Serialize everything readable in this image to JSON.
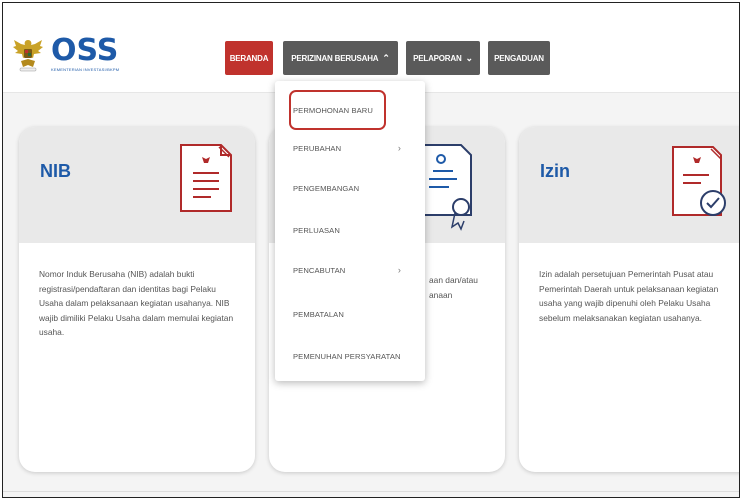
{
  "brand": {
    "logo_text": "OSS",
    "logo_subtext": "KEMENTERIAN INVESTASI/BKPM"
  },
  "nav": {
    "beranda": "BERANDA",
    "perizinan": "PERIZINAN BERUSAHA",
    "pelaporan": "PELAPORAN",
    "pengaduan": "PENGADUAN"
  },
  "dropdown": {
    "items": [
      {
        "label": "PERMOHONAN BARU",
        "has_submenu": false
      },
      {
        "label": "PERUBAHAN",
        "has_submenu": true
      },
      {
        "label": "PENGEMBANGAN",
        "has_submenu": false
      },
      {
        "label": "PERLUASAN",
        "has_submenu": false
      },
      {
        "label": "PENCABUTAN",
        "has_submenu": true
      },
      {
        "label": "PEMBATALAN",
        "has_submenu": false
      },
      {
        "label": "PEMENUHAN PERSYARATAN",
        "has_submenu": false
      }
    ]
  },
  "cards": {
    "nib": {
      "title": "NIB",
      "description": "Nomor Induk Berusaha (NIB) adalah bukti registrasi/pendaftaran dan identitas bagi Pelaku Usaha dalam pelaksanaan kegiatan usahanya. NIB wajib dimiliki Pelaku Usaha dalam memulai kegiatan usaha."
    },
    "middle": {
      "description_fragment_1": "aan dan/atau",
      "description_fragment_2": "anaan"
    },
    "izin": {
      "title": "Izin",
      "description": "Izin adalah persetujuan Pemerintah Pusat atau Pemerintah Daerah untuk pelaksanaan kegiatan usaha yang wajib dipenuhi oleh Pelaku Usaha sebelum melaksanakan kegiatan usahanya."
    }
  },
  "colors": {
    "brand_blue": "#1e5aa8",
    "accent_red": "#c0322d",
    "nav_gray": "#5a5a5a"
  },
  "icons": {
    "nib": "document-certificate-icon",
    "middle": "certificate-award-icon",
    "izin": "document-check-icon"
  }
}
